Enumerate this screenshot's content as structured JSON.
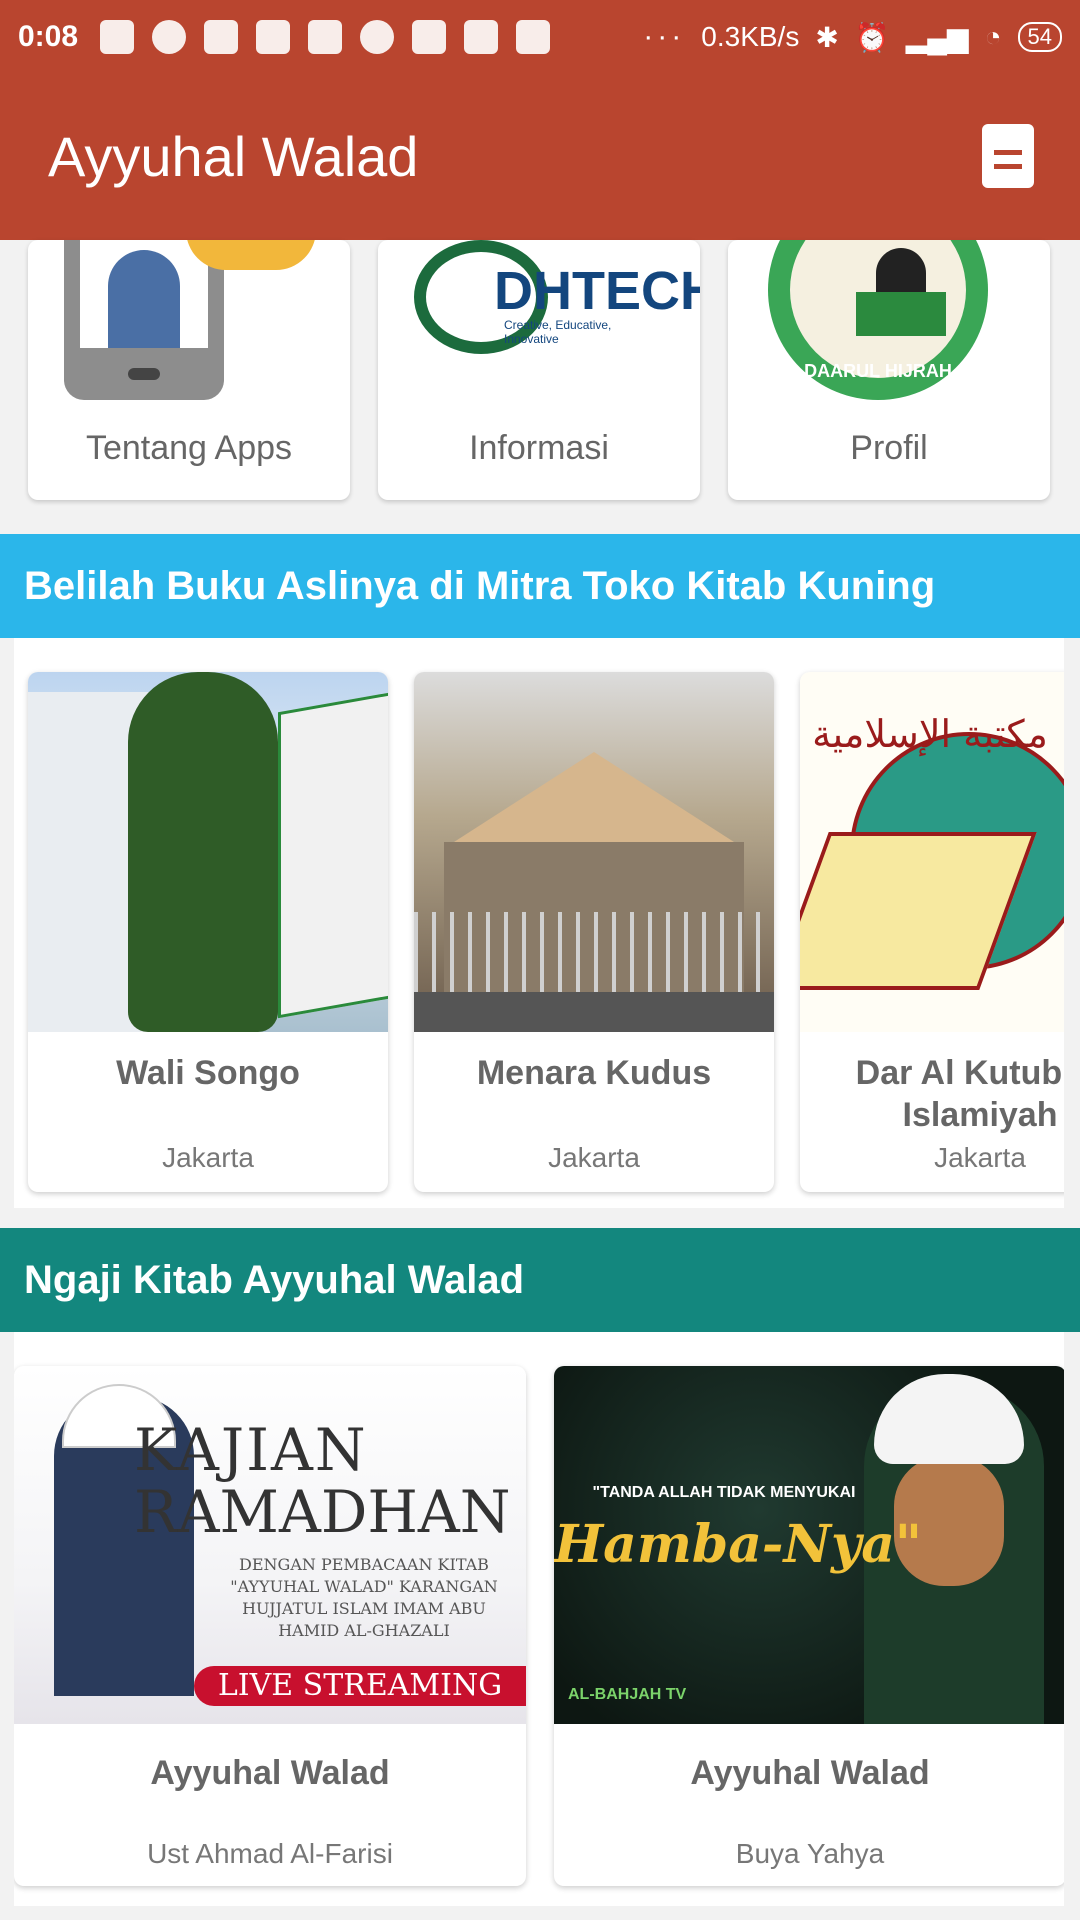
{
  "status_bar": {
    "time": "0:08",
    "network_speed": "0.3KB/s",
    "battery": "54",
    "more": "···"
  },
  "app_bar": {
    "title": "Ayyuhal Walad",
    "action_icon": "document-icon",
    "color": "#b9452f"
  },
  "menu": [
    {
      "label": "Tentang Apps",
      "icon": "phone-user-illustration"
    },
    {
      "label": "Informasi",
      "icon": "dh-tech-logo",
      "logo_text": "DHTECH",
      "logo_sub": "Creative, Educative, Innovative"
    },
    {
      "label": "Profil",
      "icon": "daarul-hijrah-seal",
      "logo_text": "DAARUL HIJRAH"
    }
  ],
  "sections": {
    "stores": {
      "title": "Belilah Buku Aslinya di Mitra Toko Kitab Kuning",
      "color": "#2bb6ea",
      "items": [
        {
          "name": "Wali Songo",
          "city": "Jakarta"
        },
        {
          "name": "Menara Kudus",
          "city": "Jakarta"
        },
        {
          "name": "Dar Al Kutub Al Islamiyah",
          "city": "Jakarta"
        }
      ]
    },
    "videos": {
      "title": "Ngaji Kitab Ayyuhal Walad",
      "color": "#13877e",
      "items": [
        {
          "title": "Ayyuhal Walad",
          "author": "Ust Ahmad Al-Farisi",
          "thumb_line1": "KAJIAN",
          "thumb_line2": "RAMADHAN",
          "thumb_sub": "DENGAN PEMBACAAN KITAB \"AYYUHAL WALAD\" KARANGAN HUJJATUL ISLAM IMAM ABU HAMID AL-GHAZALI",
          "thumb_badge": "LIVE STREAMING"
        },
        {
          "title": "Ayyuhal Walad",
          "author": "Buya Yahya",
          "thumb_quote": "\"TANDA ALLAH TIDAK MENYUKAI",
          "thumb_big": "Hamba-Nya\"",
          "thumb_channel": "AL-BAHJAH TV"
        }
      ]
    }
  }
}
